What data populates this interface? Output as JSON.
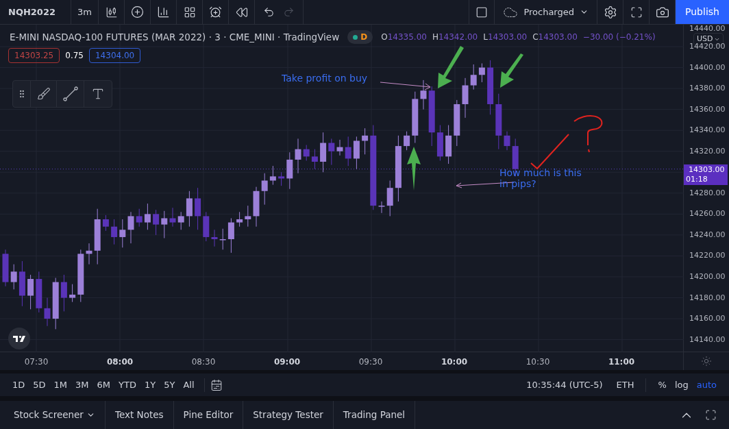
{
  "toolbar": {
    "symbol": "NQH2022",
    "interval": "3m",
    "layout_name": "Procharged",
    "publish": "Publish"
  },
  "legend": {
    "title": "E-MINI NASDAQ-100 FUTURES (MAR 2022) · 3 · CME_MINI · TradingView",
    "badge": "D",
    "ohlc": [
      {
        "label": "O",
        "value": "14335.00"
      },
      {
        "label": "H",
        "value": "14342.00"
      },
      {
        "label": "L",
        "value": "14303.00"
      },
      {
        "label": "C",
        "value": "14303.00"
      }
    ],
    "change": "−30.00 (−0.21%)"
  },
  "quote": {
    "bid": "14303.25",
    "spread": "0.75",
    "ask": "14304.00"
  },
  "annotations": [
    {
      "kind": "note",
      "text": "Take profit on buy"
    },
    {
      "kind": "question",
      "text": "How much is this in pips?"
    }
  ],
  "price_axis": {
    "currency": "USD",
    "partial_tick": "14440.00",
    "ticks": [
      "14420.00",
      "14400.00",
      "14380.00",
      "14360.00",
      "14340.00",
      "14320.00",
      "14280.00",
      "14260.00",
      "14240.00",
      "14220.00",
      "14200.00",
      "14180.00",
      "14160.00",
      "14140.00"
    ],
    "current_price": "14303.00",
    "countdown": "01:18"
  },
  "time_axis": [
    {
      "label": "07:30",
      "major": false
    },
    {
      "label": "08:00",
      "major": true
    },
    {
      "label": "08:30",
      "major": false
    },
    {
      "label": "09:00",
      "major": true
    },
    {
      "label": "09:30",
      "major": false
    },
    {
      "label": "10:00",
      "major": true
    },
    {
      "label": "10:30",
      "major": false
    },
    {
      "label": "11:00",
      "major": true
    }
  ],
  "ranges": [
    "1D",
    "5D",
    "1M",
    "3M",
    "6M",
    "YTD",
    "1Y",
    "5Y",
    "All"
  ],
  "status": {
    "time": "10:35:44 (UTC-5)",
    "session": "ETH",
    "scale_options": [
      {
        "label": "%",
        "selected": false
      },
      {
        "label": "log",
        "selected": false
      },
      {
        "label": "auto",
        "selected": true
      }
    ]
  },
  "bottom_tabs": [
    {
      "label": "Stock Screener",
      "dropdown": true
    },
    {
      "label": "Text Notes",
      "dropdown": false
    },
    {
      "label": "Pine Editor",
      "dropdown": false
    },
    {
      "label": "Strategy Tester",
      "dropdown": false
    },
    {
      "label": "Trading Panel",
      "dropdown": false
    }
  ]
}
